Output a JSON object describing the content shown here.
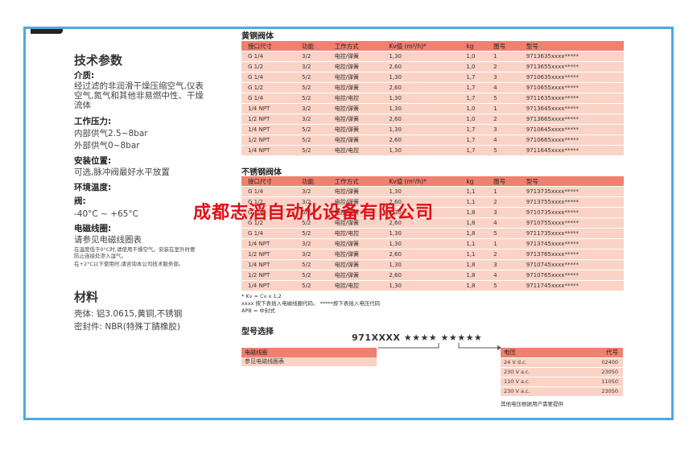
{
  "tech": {
    "title": "技术参数",
    "medium_label": "介质:",
    "medium_text_1": "经过滤的非润滑干燥压缩空气,仪表",
    "medium_text_2": "空气,氮气和其他非易燃中性、干燥",
    "medium_text_3": "流体",
    "pressure_label": "工作压力:",
    "pressure_text_1": "内部供气2.5~8bar",
    "pressure_text_2": "外部供气0~8bar",
    "install_label": "安装位置:",
    "install_text": "可选,脉冲阀最好水平放置",
    "temp_label": "环境温度:",
    "valve_label": "阀:",
    "valve_temp": "-40°C ~ +65°C",
    "coil_label": "电磁线圈:",
    "coil_text": "请参见电磁线圈表",
    "small_1": "在温度低于0°C时,请使用干燥空气。安装在室外时要",
    "small_2": "防止连接处渗入湿气。",
    "small_3": "在+2°C以下使用时,请咨询本公司技术服务部。"
  },
  "material": {
    "title": "材料",
    "body": "壳体: 铝3.0615,黄铜,不锈钢",
    "seal": "密封件: NBR(特殊丁腈橡胶)"
  },
  "brass": {
    "title": "黄铜阀体",
    "headers": [
      "接口尺寸",
      "功能",
      "工作方式",
      "Kv值 (m³/h)*",
      "kg",
      "图号",
      "型号"
    ],
    "rows": [
      [
        "G 1/4",
        "3/2",
        "电控/弹簧",
        "1,30",
        "1,0",
        "1",
        "9713635xxxx*****"
      ],
      [
        "G 1/2",
        "3/2",
        "电控/弹簧",
        "2,60",
        "1,0",
        "2",
        "9713655xxxx*****"
      ],
      [
        "G 1/4",
        "5/2",
        "电控/弹簧",
        "1,30",
        "1,7",
        "3",
        "9710635xxxx*****"
      ],
      [
        "G 1/2",
        "5/2",
        "电控/弹簧",
        "2,60",
        "1,7",
        "4",
        "9710655xxxx*****"
      ],
      [
        "G 1/4",
        "5/2",
        "电控/电控",
        "1,30",
        "1,7",
        "5",
        "9711635xxxx*****"
      ],
      [
        "1/4 NPT",
        "3/2",
        "电控/弹簧",
        "1,30",
        "1,0",
        "1",
        "9713645xxxx*****"
      ],
      [
        "1/2 NPT",
        "3/2",
        "电控/弹簧",
        "2,60",
        "1,0",
        "2",
        "9713665xxxx*****"
      ],
      [
        "1/4 NPT",
        "5/2",
        "电控/弹簧",
        "1,30",
        "1,7",
        "3",
        "9710645xxxx*****"
      ],
      [
        "1/2 NPT",
        "5/2",
        "电控/弹簧",
        "2,60",
        "1,7",
        "4",
        "9710665xxxx*****"
      ],
      [
        "1/4 NPT",
        "5/2",
        "电控/电控",
        "1,30",
        "1,7",
        "5",
        "9711645xxxx*****"
      ]
    ]
  },
  "steel": {
    "title": "不锈钢阀体",
    "headers": [
      "接口尺寸",
      "功能",
      "工作方式",
      "Kv值 (m³/h)*",
      "kg",
      "图号",
      "型号"
    ],
    "rows": [
      [
        "G 1/4",
        "3/2",
        "电控/弹簧",
        "1,30",
        "1,1",
        "1",
        "9713735xxxx*****"
      ],
      [
        "G 1/2",
        "3/2",
        "电控/弹簧",
        "2,60",
        "1,1",
        "2",
        "9713755xxxx*****"
      ],
      [
        "G 1/4",
        "5/2",
        "电控/弹簧",
        "1,30",
        "1,8",
        "3",
        "9710735xxxx*****"
      ],
      [
        "G 1/2",
        "5/2",
        "电控/弹簧",
        "2,60",
        "1,8",
        "4",
        "9710755xxxx*****"
      ],
      [
        "G 1/4",
        "5/2",
        "电控/电控",
        "1,30",
        "1,8",
        "5",
        "9711735xxxx*****"
      ],
      [
        "1/4 NPT",
        "3/2",
        "电控/弹簧",
        "1,30",
        "1,1",
        "1",
        "9713745xxxx*****"
      ],
      [
        "1/2 NPT",
        "3/2",
        "电控/弹簧",
        "2,60",
        "1,1",
        "2",
        "9713765xxxx*****"
      ],
      [
        "1/4 NPT",
        "5/2",
        "电控/弹簧",
        "1,30",
        "1,8",
        "3",
        "9710745xxxx*****"
      ],
      [
        "1/2 NPT",
        "5/2",
        "电控/弹簧",
        "2,60",
        "1,8",
        "4",
        "9710765xxxx*****"
      ],
      [
        "1/4 NPT",
        "5/2",
        "电控/电控",
        "1,30",
        "1,8",
        "5",
        "9711745xxxx*****"
      ]
    ]
  },
  "notes": {
    "kv": "* Kv = Cv x 1,2",
    "xxxx": "xxxx 按下表插入电磁线圈代码。   *****按下表插入电压代码",
    "apb": "APB = 中封式"
  },
  "model": {
    "title": "型号选择",
    "code": "971XXXX ★★★★ ★★★★★",
    "coil_header": "电磁线圈",
    "coil_row": "参见电磁线圈表",
    "voltage_header": "电压",
    "code_header": "代号",
    "voltages": [
      [
        "24 V d.c.",
        "02400"
      ],
      [
        "230 V a.c.",
        "23050"
      ],
      [
        "110 V a.c.",
        "11050"
      ],
      [
        "230 V a.c.",
        "23050"
      ]
    ],
    "voltage_note": "其他电压根据用户需要提供"
  },
  "watermark": "成都志滔自动化设备有限公司",
  "colors": {
    "frame": "#4ea8e6",
    "header": "#f08070",
    "row": "#fbd3c6",
    "watermark": "#e0101a"
  }
}
